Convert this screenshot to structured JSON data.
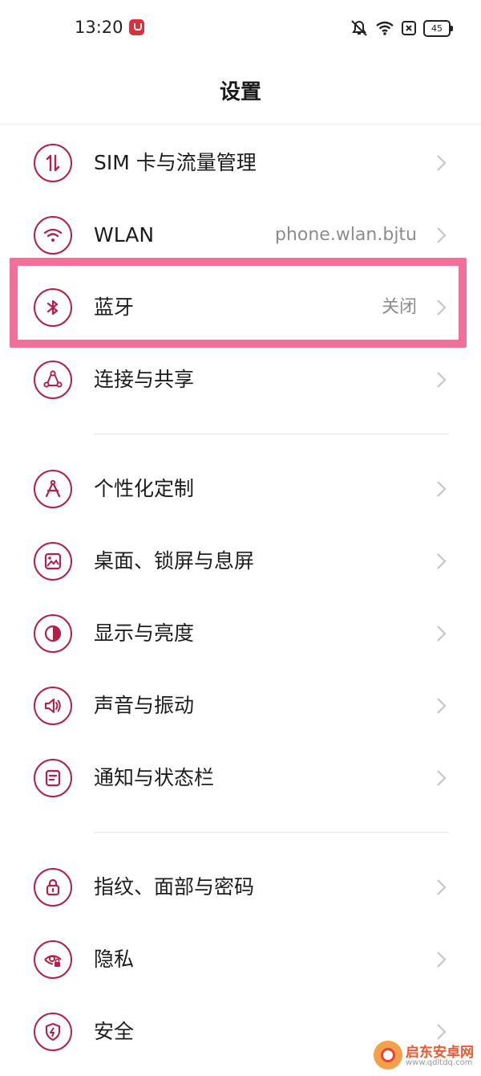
{
  "status_bar": {
    "time": "13:20",
    "icons": [
      "app-notification-icon",
      "mute-icon",
      "wifi-icon",
      "sim-error-icon"
    ],
    "battery": "45"
  },
  "header": {
    "title": "设置"
  },
  "accent_color": "#b3204a",
  "highlight_color": "#f0709a",
  "groups": [
    {
      "items": [
        {
          "label": "SIM 卡与流量管理",
          "value": "",
          "icon": "sim-data-icon"
        },
        {
          "label": "WLAN",
          "value": "phone.wlan.bjtu",
          "icon": "wifi-icon"
        },
        {
          "label": "蓝牙",
          "value": "关闭",
          "icon": "bluetooth-icon"
        },
        {
          "label": "连接与共享",
          "value": "",
          "icon": "share-connection-icon"
        }
      ]
    },
    {
      "items": [
        {
          "label": "个性化定制",
          "value": "",
          "icon": "compass-drafting-icon"
        },
        {
          "label": "桌面、锁屏与息屏",
          "value": "",
          "icon": "wallpaper-icon"
        },
        {
          "label": "显示与亮度",
          "value": "",
          "icon": "brightness-icon"
        },
        {
          "label": "声音与振动",
          "value": "",
          "icon": "speaker-icon"
        },
        {
          "label": "通知与状态栏",
          "value": "",
          "icon": "notification-panel-icon"
        }
      ]
    },
    {
      "items": [
        {
          "label": "指纹、面部与密码",
          "value": "",
          "icon": "lock-icon"
        },
        {
          "label": "隐私",
          "value": "",
          "icon": "privacy-eye-icon"
        },
        {
          "label": "安全",
          "value": "",
          "icon": "shield-icon"
        }
      ]
    }
  ],
  "watermark": {
    "name": "启东安卓网",
    "url": "www.qdltdq.com"
  }
}
